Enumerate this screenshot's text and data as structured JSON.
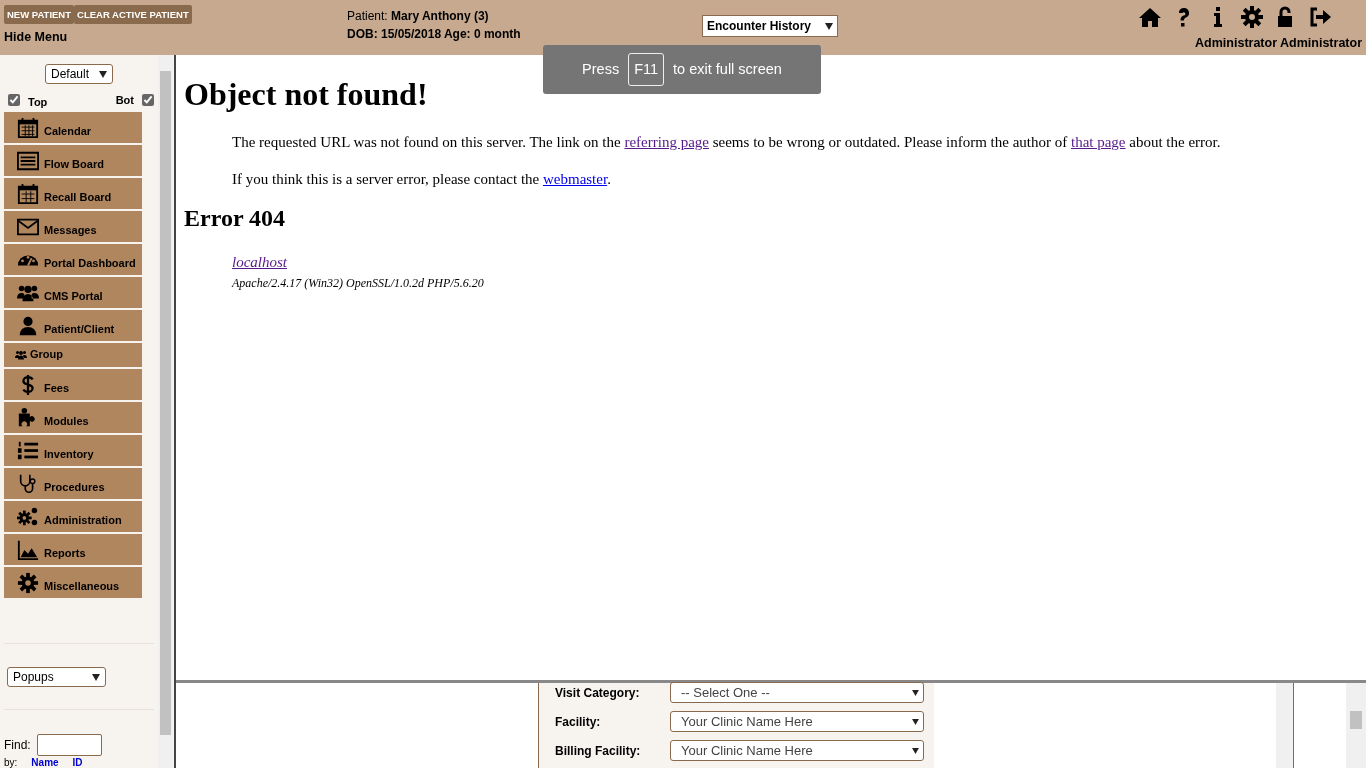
{
  "header": {
    "buttons": [
      "NEW PATIENT",
      "CLEAR ACTIVE PATIENT"
    ],
    "hide_menu": "Hide Menu",
    "patient_label": "Patient:",
    "patient_name": "Mary Anthony (3)",
    "dob_line": "DOB: 15/05/2018 Age: 0 month",
    "encounter_select": "Encounter History",
    "user": "Administrator Administrator"
  },
  "fullscreen_toast": {
    "before": "Press",
    "key": "F11",
    "after": "to exit full screen"
  },
  "sidebar": {
    "view_select": "Default",
    "toggles": [
      {
        "label": "Top",
        "checked": true
      },
      {
        "label": "Bot",
        "checked": true
      }
    ],
    "items": [
      {
        "label": "Calendar",
        "kind": "standard"
      },
      {
        "label": "Flow Board",
        "kind": "standard"
      },
      {
        "label": "Recall Board",
        "kind": "standard"
      },
      {
        "label": "Messages",
        "kind": "standard"
      },
      {
        "label": "Portal Dashboard",
        "kind": "standard"
      },
      {
        "label": "CMS Portal",
        "kind": "standard"
      },
      {
        "label": "Patient/Client",
        "kind": "standard"
      },
      {
        "label": "Group",
        "kind": "compact"
      },
      {
        "label": "Fees",
        "kind": "standard"
      },
      {
        "label": "Modules",
        "kind": "standard"
      },
      {
        "label": "Inventory",
        "kind": "standard"
      },
      {
        "label": "Procedures",
        "kind": "standard"
      },
      {
        "label": "Administration",
        "kind": "standard"
      },
      {
        "label": "Reports",
        "kind": "standard"
      },
      {
        "label": "Miscellaneous",
        "kind": "standard"
      }
    ],
    "popups_select": "Popups",
    "find_label": "Find:",
    "by_label": "by:",
    "by_links": [
      "Name",
      "ID"
    ]
  },
  "content": {
    "title": "Object not found!",
    "paragraphs": [
      [
        {
          "kind": "text",
          "text": "The requested URL was not found on this server. The link on the "
        },
        {
          "kind": "link",
          "text": "referring page",
          "visited": true
        },
        {
          "kind": "text",
          "text": " seems to be wrong or outdated. Please inform the author of "
        },
        {
          "kind": "link",
          "text": "that page",
          "visited": true
        },
        {
          "kind": "text",
          "text": " about the error."
        }
      ],
      [
        {
          "kind": "text",
          "text": "If you think this is a server error, please contact the "
        },
        {
          "kind": "link",
          "text": "webmaster",
          "visited": false
        },
        {
          "kind": "text",
          "text": "."
        }
      ]
    ],
    "error_heading": "Error 404",
    "host_link": {
      "text": "localhost",
      "visited": true
    },
    "server_info": "Apache/2.4.17 (Win32) OpenSSL/1.0.2d PHP/5.6.20"
  },
  "encounter_form": {
    "fields": [
      {
        "label": "Visit Category:",
        "value": "-- Select One --"
      },
      {
        "label": "Facility:",
        "value": "Your Clinic Name Here"
      },
      {
        "label": "Billing Facility:",
        "value": "Your Clinic Name Here"
      }
    ]
  }
}
